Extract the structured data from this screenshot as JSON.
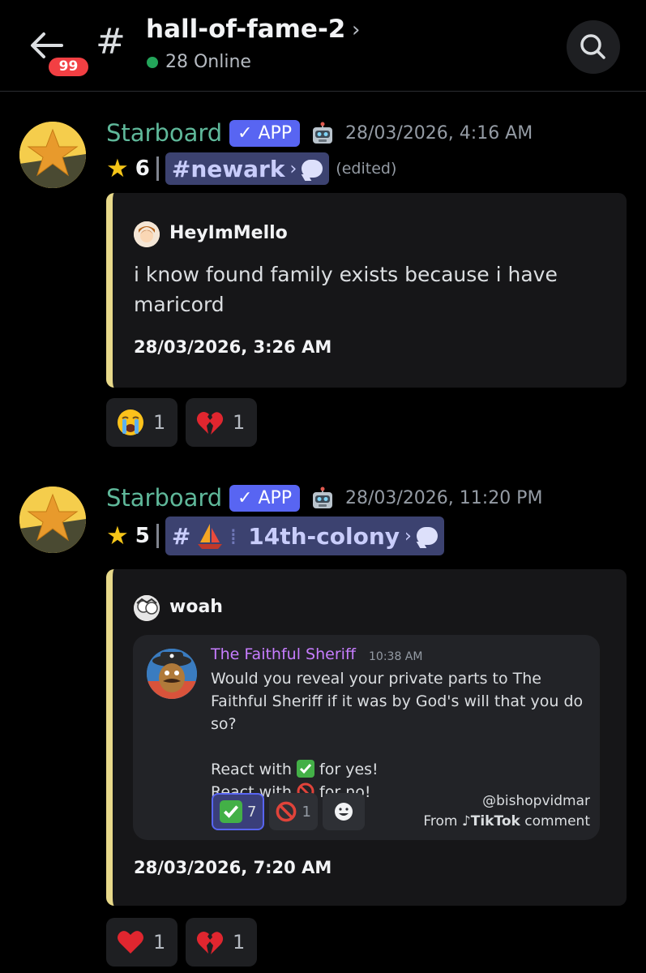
{
  "header": {
    "unread_badge": "99",
    "channel_name": "hall-of-fame-2",
    "online_text": "28 Online"
  },
  "messages": [
    {
      "author": "Starboard",
      "app_tag": "APP",
      "timestamp": "28/03/2026, 4:16 AM",
      "star_count": "6",
      "channel_mention": "newark",
      "edited_label": "(edited)",
      "embed": {
        "author": "HeyImMello",
        "description": "i know found family exists because i have maricord",
        "timestamp": "28/03/2026, 3:26 AM"
      },
      "reactions": [
        {
          "emoji": "loudly-crying-face",
          "count": "1"
        },
        {
          "emoji": "broken-heart",
          "count": "1"
        }
      ]
    },
    {
      "author": "Starboard",
      "app_tag": "APP",
      "timestamp": "28/03/2026, 11:20 PM",
      "star_count": "5",
      "channel_mention": "14th-colony",
      "embed": {
        "author": "woah",
        "timestamp": "28/03/2026, 7:20 AM",
        "image_message": {
          "author": "The Faithful Sheriff",
          "time": "10:38 AM",
          "line1": "Would you reveal your private parts to The Faithful Sheriff if it was by God's will that you do so?",
          "line2": "React with",
          "line2_end": "for yes!",
          "line3": "React with",
          "line3_end": "for no!",
          "reactions": [
            {
              "emoji": "check-mark-button",
              "count": "7"
            },
            {
              "emoji": "prohibited",
              "count": "1"
            }
          ],
          "tiktok_handle": "@bishopvidmar",
          "tiktok_from": "From",
          "tiktok_brand": "TikTok",
          "tiktok_suffix": "comment"
        }
      },
      "reactions": [
        {
          "emoji": "red-heart",
          "count": "1"
        },
        {
          "emoji": "broken-heart",
          "count": "1"
        }
      ]
    }
  ],
  "colors": {
    "background": "#000000",
    "author_green": "#5fb89a",
    "app_tag": "#5865f2",
    "mention_bg": "#3c4270",
    "embed_bar": "#e8d98a",
    "sheriff_name": "#c77dff",
    "online": "#23a55a",
    "badge": "#f23f43"
  }
}
